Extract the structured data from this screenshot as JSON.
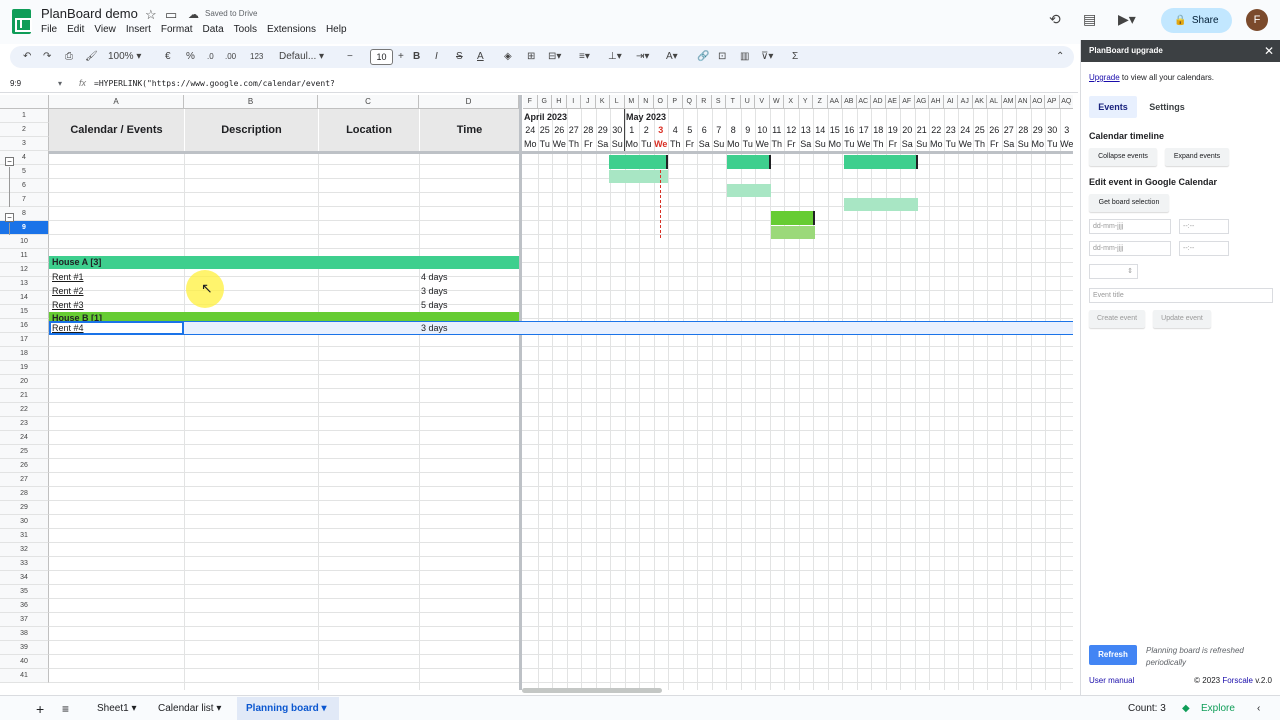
{
  "doc": {
    "title": "PlanBoard demo",
    "saved": "Saved to Drive"
  },
  "menu": [
    "File",
    "Edit",
    "View",
    "Insert",
    "Format",
    "Data",
    "Tools",
    "Extensions",
    "Help"
  ],
  "topright": {
    "share": "Share",
    "avatar": "F"
  },
  "toolbar": {
    "zoom": "100%",
    "currency": "€",
    "percent": "%",
    "decimals": "123",
    "font": "Defaul...",
    "font_size": "10"
  },
  "formula_bar": {
    "cell_ref": "9:9",
    "fx": "fx",
    "formula": "=HYPERLINK(\"https://www.google.com/calendar/event?"
  },
  "columns": {
    "a": "A",
    "b": "B",
    "c": "C",
    "d": "D"
  },
  "timeline_cols": [
    "F",
    "G",
    "H",
    "I",
    "J",
    "K",
    "L",
    "M",
    "N",
    "O",
    "P",
    "Q",
    "R",
    "S",
    "T",
    "U",
    "V",
    "W",
    "X",
    "Y",
    "Z",
    "AA",
    "AB",
    "AC",
    "AD",
    "AE",
    "AF",
    "AG",
    "AH",
    "AI",
    "AJ",
    "AK",
    "AL",
    "AM",
    "AN",
    "AO",
    "AP",
    "AQ"
  ],
  "months": {
    "april": "April 2023",
    "may": "May 2023"
  },
  "days": [
    "24",
    "25",
    "26",
    "27",
    "28",
    "29",
    "30",
    "1",
    "2",
    "3",
    "4",
    "5",
    "6",
    "7",
    "8",
    "9",
    "10",
    "11",
    "12",
    "13",
    "14",
    "15",
    "16",
    "17",
    "18",
    "19",
    "20",
    "21",
    "22",
    "23",
    "24",
    "25",
    "26",
    "27",
    "28",
    "29",
    "30",
    "3"
  ],
  "weekdays": [
    "Mo",
    "Tu",
    "We",
    "Th",
    "Fr",
    "Sa",
    "Su",
    "Mo",
    "Tu",
    "We",
    "Th",
    "Fr",
    "Sa",
    "Su",
    "Mo",
    "Tu",
    "We",
    "Th",
    "Fr",
    "Sa",
    "Su",
    "Mo",
    "Tu",
    "We",
    "Th",
    "Fr",
    "Sa",
    "Su",
    "Mo",
    "Tu",
    "We",
    "Th",
    "Fr",
    "Sa",
    "Su",
    "Mo",
    "Tu",
    "We"
  ],
  "headers": {
    "calendar_events": "Calendar / Events",
    "description": "Description",
    "location": "Location",
    "time": "Time"
  },
  "rows": {
    "house_a": "House A [3]",
    "rent1": {
      "name": "Rent #1",
      "time": "4 days"
    },
    "rent2": {
      "name": "Rent #2",
      "time": "3 days"
    },
    "rent3": {
      "name": "Rent #3",
      "time": "5 days"
    },
    "house_b": "House B [1]",
    "rent4": {
      "name": "Rent #4",
      "time": "3 days"
    }
  },
  "row_numbers": [
    "1",
    "2",
    "3",
    "4",
    "5",
    "6",
    "7",
    "8",
    "9",
    "10",
    "11",
    "12",
    "13",
    "14",
    "15",
    "16",
    "17",
    "18",
    "19",
    "20",
    "21",
    "22",
    "23",
    "24",
    "25",
    "26",
    "27",
    "28",
    "29",
    "30",
    "31",
    "32",
    "33",
    "34",
    "35",
    "36",
    "37",
    "38",
    "39",
    "40",
    "41"
  ],
  "sidebar": {
    "title": "PlanBoard upgrade",
    "upgrade_link": "Upgrade",
    "upgrade_text": " to view all your calendars.",
    "tab_events": "Events",
    "tab_settings": "Settings",
    "timeline_heading": "Calendar timeline",
    "collapse": "Collapse events",
    "expand": "Expand events",
    "edit_heading": "Edit event in Google Calendar",
    "get_selection": "Get board selection",
    "date_placeholder": "dd-mm-jjjj",
    "time_placeholder": "--:--",
    "title_placeholder": "Event title",
    "create": "Create event",
    "update": "Update event",
    "refresh": "Refresh",
    "refresh_note": "Planning board is refreshed periodically",
    "manual": "User manual",
    "copyright": "© 2023",
    "brand": "Forscale",
    "version": "v.2.0"
  },
  "sheets": {
    "sheet1": "Sheet1",
    "calendar_list": "Calendar list",
    "planning_board": "Planning board"
  },
  "status": {
    "count": "Count: 3",
    "explore": "Explore"
  },
  "colors": {
    "house_a": "#3ecf8e",
    "house_b": "#66cc33",
    "event_light": "#a8e6c4",
    "today_red": "#d93025",
    "selected_row": "#e8f0fe",
    "sheet_tab_active": "#1a73e8"
  }
}
